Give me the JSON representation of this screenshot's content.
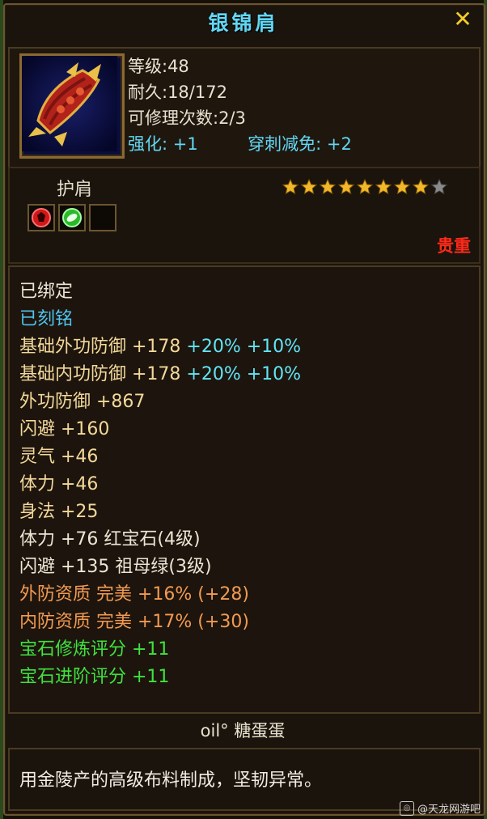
{
  "window": {
    "title": "银锦肩",
    "close_label": "✕"
  },
  "item": {
    "level": "等级:48",
    "durability": "耐久:18/172",
    "repair_count": "可修理次数:2/3",
    "enhance": "强化: +1",
    "pierce_reduction": "穿刺减免: +2",
    "slot_type": "护肩",
    "rarity": "贵重",
    "stars_filled": 8,
    "stars_total": 9,
    "gem_slots": [
      "red-gem-icon",
      "green-gem-icon",
      "empty-slot"
    ]
  },
  "stats": [
    {
      "text": "已绑定",
      "color": "white"
    },
    {
      "text": "已刻铭",
      "color": "blue"
    },
    {
      "text": "基础外功防御 +178 ",
      "color": "gold",
      "extra": "+20% +10%",
      "extra_color": "teal"
    },
    {
      "text": "基础内功防御 +178 ",
      "color": "gold",
      "extra": "+20% +10%",
      "extra_color": "teal"
    },
    {
      "text": "外功防御 +867",
      "color": "gold"
    },
    {
      "text": "闪避 +160",
      "color": "gold"
    },
    {
      "text": "灵气 +46",
      "color": "gold"
    },
    {
      "text": "体力 +46",
      "color": "gold"
    },
    {
      "text": "身法 +25",
      "color": "gold"
    },
    {
      "text": "体力 +76 红宝石(4级)",
      "color": "white"
    },
    {
      "text": "闪避 +135 祖母绿(3级)",
      "color": "white"
    },
    {
      "text": "外防资质  完美 +16% (+28)",
      "color": "orange"
    },
    {
      "text": "内防资质  完美 +17% (+30)",
      "color": "orange"
    },
    {
      "text": "宝石修炼评分 +11",
      "color": "green"
    },
    {
      "text": "宝石进阶评分 +11",
      "color": "green"
    }
  ],
  "author": "oil° 糖蛋蛋",
  "description": "用金陵产的高级布料制成，坚韧异常。",
  "watermark": "@天龙网游吧"
}
